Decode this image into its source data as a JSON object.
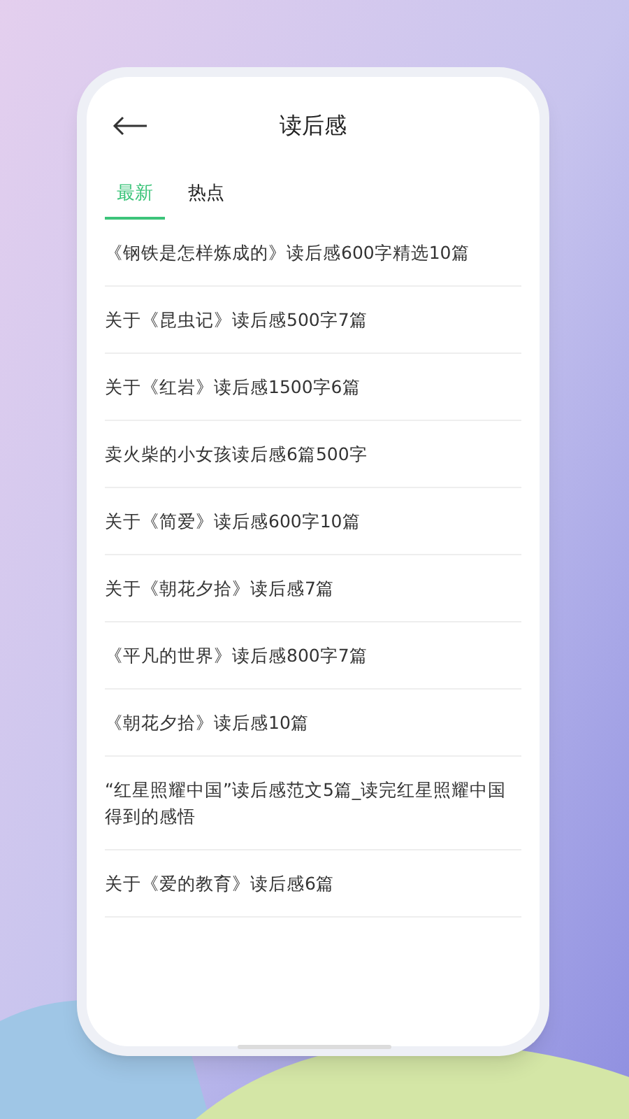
{
  "header": {
    "title": "读后感"
  },
  "tabs": [
    {
      "label": "最新",
      "selected": true
    },
    {
      "label": "热点",
      "selected": false
    }
  ],
  "articles": [
    {
      "title": "《钢铁是怎样炼成的》读后感600字精选10篇"
    },
    {
      "title": "关于《昆虫记》读后感500字7篇"
    },
    {
      "title": "关于《红岩》读后感1500字6篇"
    },
    {
      "title": "卖火柴的小女孩读后感6篇500字"
    },
    {
      "title": "关于《简爱》读后感600字10篇"
    },
    {
      "title": "关于《朝花夕拾》读后感7篇"
    },
    {
      "title": "《平凡的世界》读后感800字7篇"
    },
    {
      "title": "《朝花夕拾》读后感10篇"
    },
    {
      "title": "“红星照耀中国”读后感范文5篇_读完红星照耀中国得到的感悟"
    },
    {
      "title": "关于《爱的教育》读后感6篇"
    }
  ]
}
